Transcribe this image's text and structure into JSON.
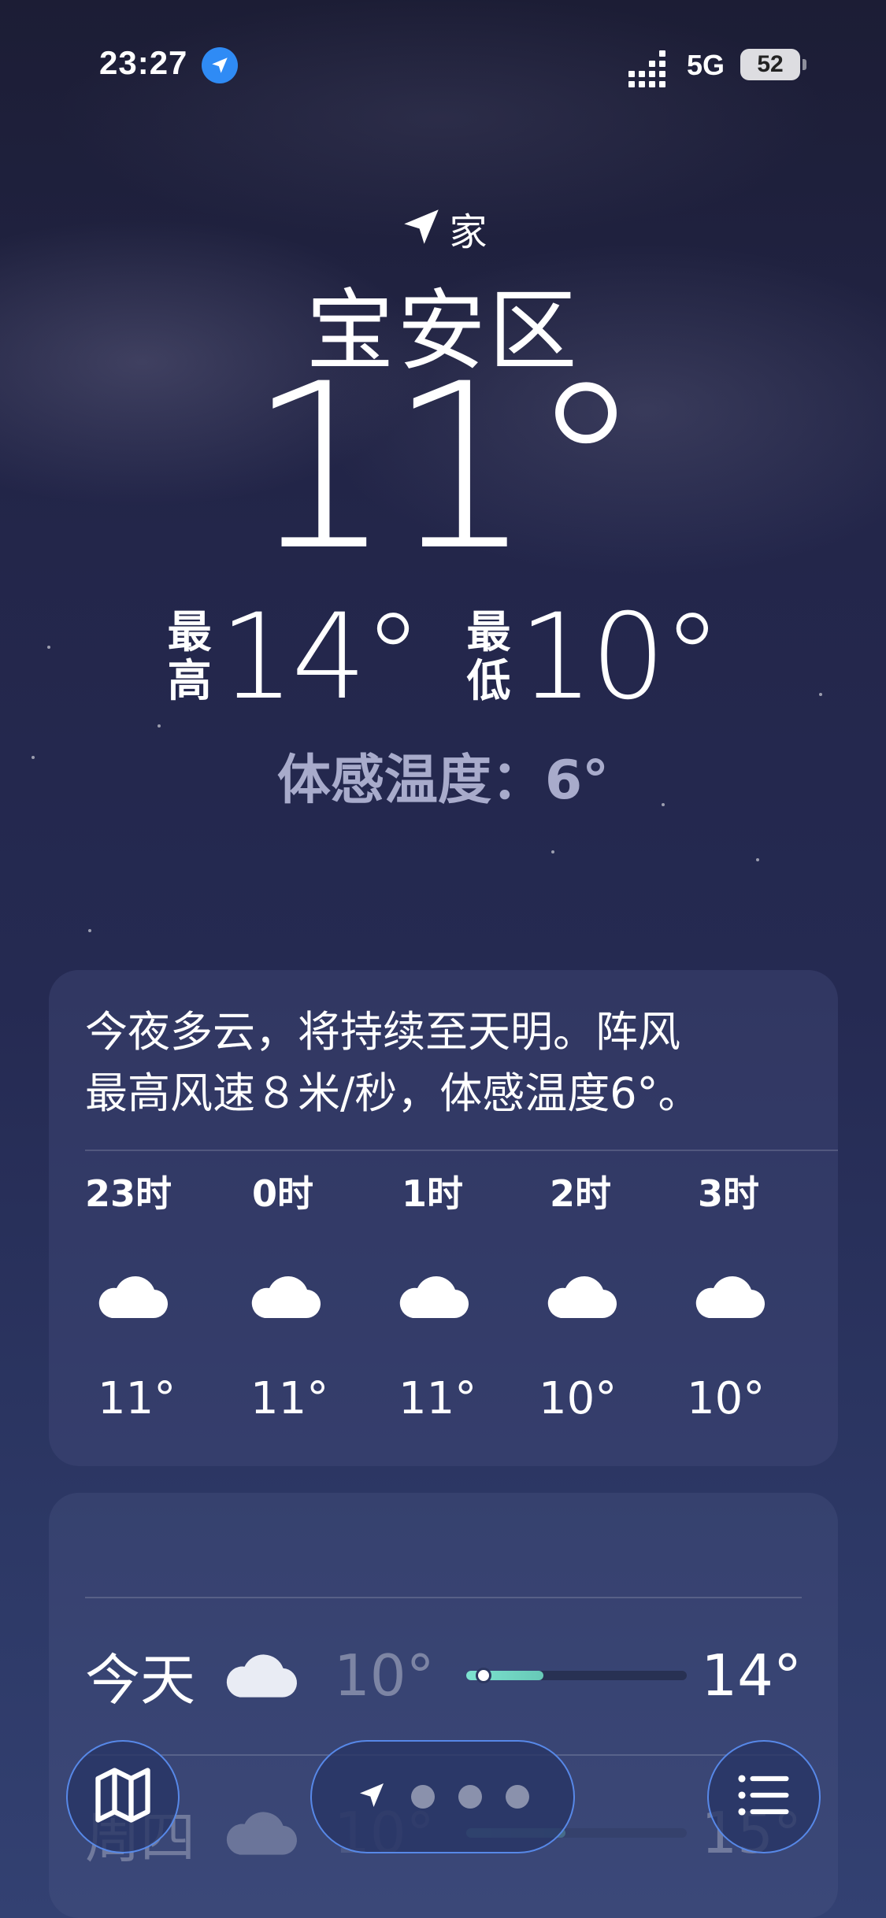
{
  "status_bar": {
    "time": "23:27",
    "network": "5G",
    "battery": "52"
  },
  "location": {
    "home_label": "家",
    "city": "宝安区"
  },
  "current": {
    "temp": "11°",
    "high_label": [
      "最",
      "高"
    ],
    "high": "14°",
    "low_label": [
      "最",
      "低"
    ],
    "low": "10°",
    "feels_like": "体感温度：6°"
  },
  "hourly": {
    "summary_line1": "今夜多云，将持续至天明。阵风",
    "summary_line2": "最高风速８米/秒，体感温度6°。",
    "items": [
      {
        "time": "23时",
        "icon": "cloud-icon",
        "temp": "11°"
      },
      {
        "time": "0时",
        "icon": "cloud-icon",
        "temp": "11°"
      },
      {
        "time": "1时",
        "icon": "cloud-icon",
        "temp": "11°"
      },
      {
        "time": "2时",
        "icon": "cloud-icon",
        "temp": "10°"
      },
      {
        "time": "3时",
        "icon": "cloud-icon",
        "temp": "10°"
      }
    ]
  },
  "daily": [
    {
      "day": "今天",
      "icon": "cloud-icon",
      "low": "10°",
      "high": "14°",
      "range_start": 0.0,
      "range_end": 0.35,
      "current_marker": 0.08
    },
    {
      "day": "周四",
      "icon": "cloud-icon",
      "low": "10°",
      "high": "15°",
      "range_start": 0.0,
      "range_end": 0.45
    }
  ],
  "toolbar": {
    "map_icon": "map-icon",
    "current_location_icon": "location-arrow-icon",
    "page_count": 3,
    "list_icon": "list-icon"
  },
  "colors": {
    "accent_blue": "#2f8bf5",
    "range_green": "#7de3d0",
    "feels_like_text": "#a8abcb"
  }
}
